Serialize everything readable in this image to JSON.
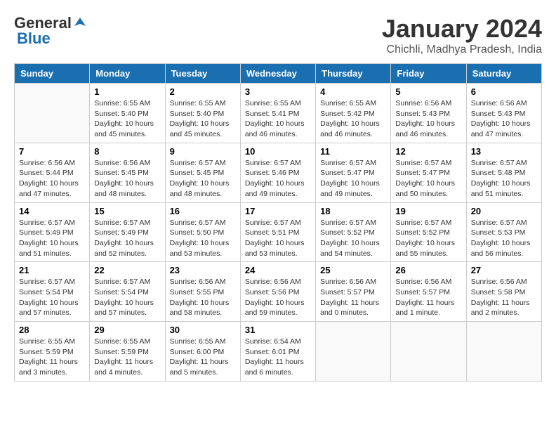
{
  "logo": {
    "general": "General",
    "blue": "Blue"
  },
  "header": {
    "month": "January 2024",
    "location": "Chichli, Madhya Pradesh, India"
  },
  "weekdays": [
    "Sunday",
    "Monday",
    "Tuesday",
    "Wednesday",
    "Thursday",
    "Friday",
    "Saturday"
  ],
  "weeks": [
    [
      {
        "day": "",
        "info": ""
      },
      {
        "day": "1",
        "info": "Sunrise: 6:55 AM\nSunset: 5:40 PM\nDaylight: 10 hours\nand 45 minutes."
      },
      {
        "day": "2",
        "info": "Sunrise: 6:55 AM\nSunset: 5:40 PM\nDaylight: 10 hours\nand 45 minutes."
      },
      {
        "day": "3",
        "info": "Sunrise: 6:55 AM\nSunset: 5:41 PM\nDaylight: 10 hours\nand 46 minutes."
      },
      {
        "day": "4",
        "info": "Sunrise: 6:55 AM\nSunset: 5:42 PM\nDaylight: 10 hours\nand 46 minutes."
      },
      {
        "day": "5",
        "info": "Sunrise: 6:56 AM\nSunset: 5:43 PM\nDaylight: 10 hours\nand 46 minutes."
      },
      {
        "day": "6",
        "info": "Sunrise: 6:56 AM\nSunset: 5:43 PM\nDaylight: 10 hours\nand 47 minutes."
      }
    ],
    [
      {
        "day": "7",
        "info": "Sunrise: 6:56 AM\nSunset: 5:44 PM\nDaylight: 10 hours\nand 47 minutes."
      },
      {
        "day": "8",
        "info": "Sunrise: 6:56 AM\nSunset: 5:45 PM\nDaylight: 10 hours\nand 48 minutes."
      },
      {
        "day": "9",
        "info": "Sunrise: 6:57 AM\nSunset: 5:45 PM\nDaylight: 10 hours\nand 48 minutes."
      },
      {
        "day": "10",
        "info": "Sunrise: 6:57 AM\nSunset: 5:46 PM\nDaylight: 10 hours\nand 49 minutes."
      },
      {
        "day": "11",
        "info": "Sunrise: 6:57 AM\nSunset: 5:47 PM\nDaylight: 10 hours\nand 49 minutes."
      },
      {
        "day": "12",
        "info": "Sunrise: 6:57 AM\nSunset: 5:47 PM\nDaylight: 10 hours\nand 50 minutes."
      },
      {
        "day": "13",
        "info": "Sunrise: 6:57 AM\nSunset: 5:48 PM\nDaylight: 10 hours\nand 51 minutes."
      }
    ],
    [
      {
        "day": "14",
        "info": "Sunrise: 6:57 AM\nSunset: 5:49 PM\nDaylight: 10 hours\nand 51 minutes."
      },
      {
        "day": "15",
        "info": "Sunrise: 6:57 AM\nSunset: 5:49 PM\nDaylight: 10 hours\nand 52 minutes."
      },
      {
        "day": "16",
        "info": "Sunrise: 6:57 AM\nSunset: 5:50 PM\nDaylight: 10 hours\nand 53 minutes."
      },
      {
        "day": "17",
        "info": "Sunrise: 6:57 AM\nSunset: 5:51 PM\nDaylight: 10 hours\nand 53 minutes."
      },
      {
        "day": "18",
        "info": "Sunrise: 6:57 AM\nSunset: 5:52 PM\nDaylight: 10 hours\nand 54 minutes."
      },
      {
        "day": "19",
        "info": "Sunrise: 6:57 AM\nSunset: 5:52 PM\nDaylight: 10 hours\nand 55 minutes."
      },
      {
        "day": "20",
        "info": "Sunrise: 6:57 AM\nSunset: 5:53 PM\nDaylight: 10 hours\nand 56 minutes."
      }
    ],
    [
      {
        "day": "21",
        "info": "Sunrise: 6:57 AM\nSunset: 5:54 PM\nDaylight: 10 hours\nand 57 minutes."
      },
      {
        "day": "22",
        "info": "Sunrise: 6:57 AM\nSunset: 5:54 PM\nDaylight: 10 hours\nand 57 minutes."
      },
      {
        "day": "23",
        "info": "Sunrise: 6:56 AM\nSunset: 5:55 PM\nDaylight: 10 hours\nand 58 minutes."
      },
      {
        "day": "24",
        "info": "Sunrise: 6:56 AM\nSunset: 5:56 PM\nDaylight: 10 hours\nand 59 minutes."
      },
      {
        "day": "25",
        "info": "Sunrise: 6:56 AM\nSunset: 5:57 PM\nDaylight: 11 hours\nand 0 minutes."
      },
      {
        "day": "26",
        "info": "Sunrise: 6:56 AM\nSunset: 5:57 PM\nDaylight: 11 hours\nand 1 minute."
      },
      {
        "day": "27",
        "info": "Sunrise: 6:56 AM\nSunset: 5:58 PM\nDaylight: 11 hours\nand 2 minutes."
      }
    ],
    [
      {
        "day": "28",
        "info": "Sunrise: 6:55 AM\nSunset: 5:59 PM\nDaylight: 11 hours\nand 3 minutes."
      },
      {
        "day": "29",
        "info": "Sunrise: 6:55 AM\nSunset: 5:59 PM\nDaylight: 11 hours\nand 4 minutes."
      },
      {
        "day": "30",
        "info": "Sunrise: 6:55 AM\nSunset: 6:00 PM\nDaylight: 11 hours\nand 5 minutes."
      },
      {
        "day": "31",
        "info": "Sunrise: 6:54 AM\nSunset: 6:01 PM\nDaylight: 11 hours\nand 6 minutes."
      },
      {
        "day": "",
        "info": ""
      },
      {
        "day": "",
        "info": ""
      },
      {
        "day": "",
        "info": ""
      }
    ]
  ]
}
